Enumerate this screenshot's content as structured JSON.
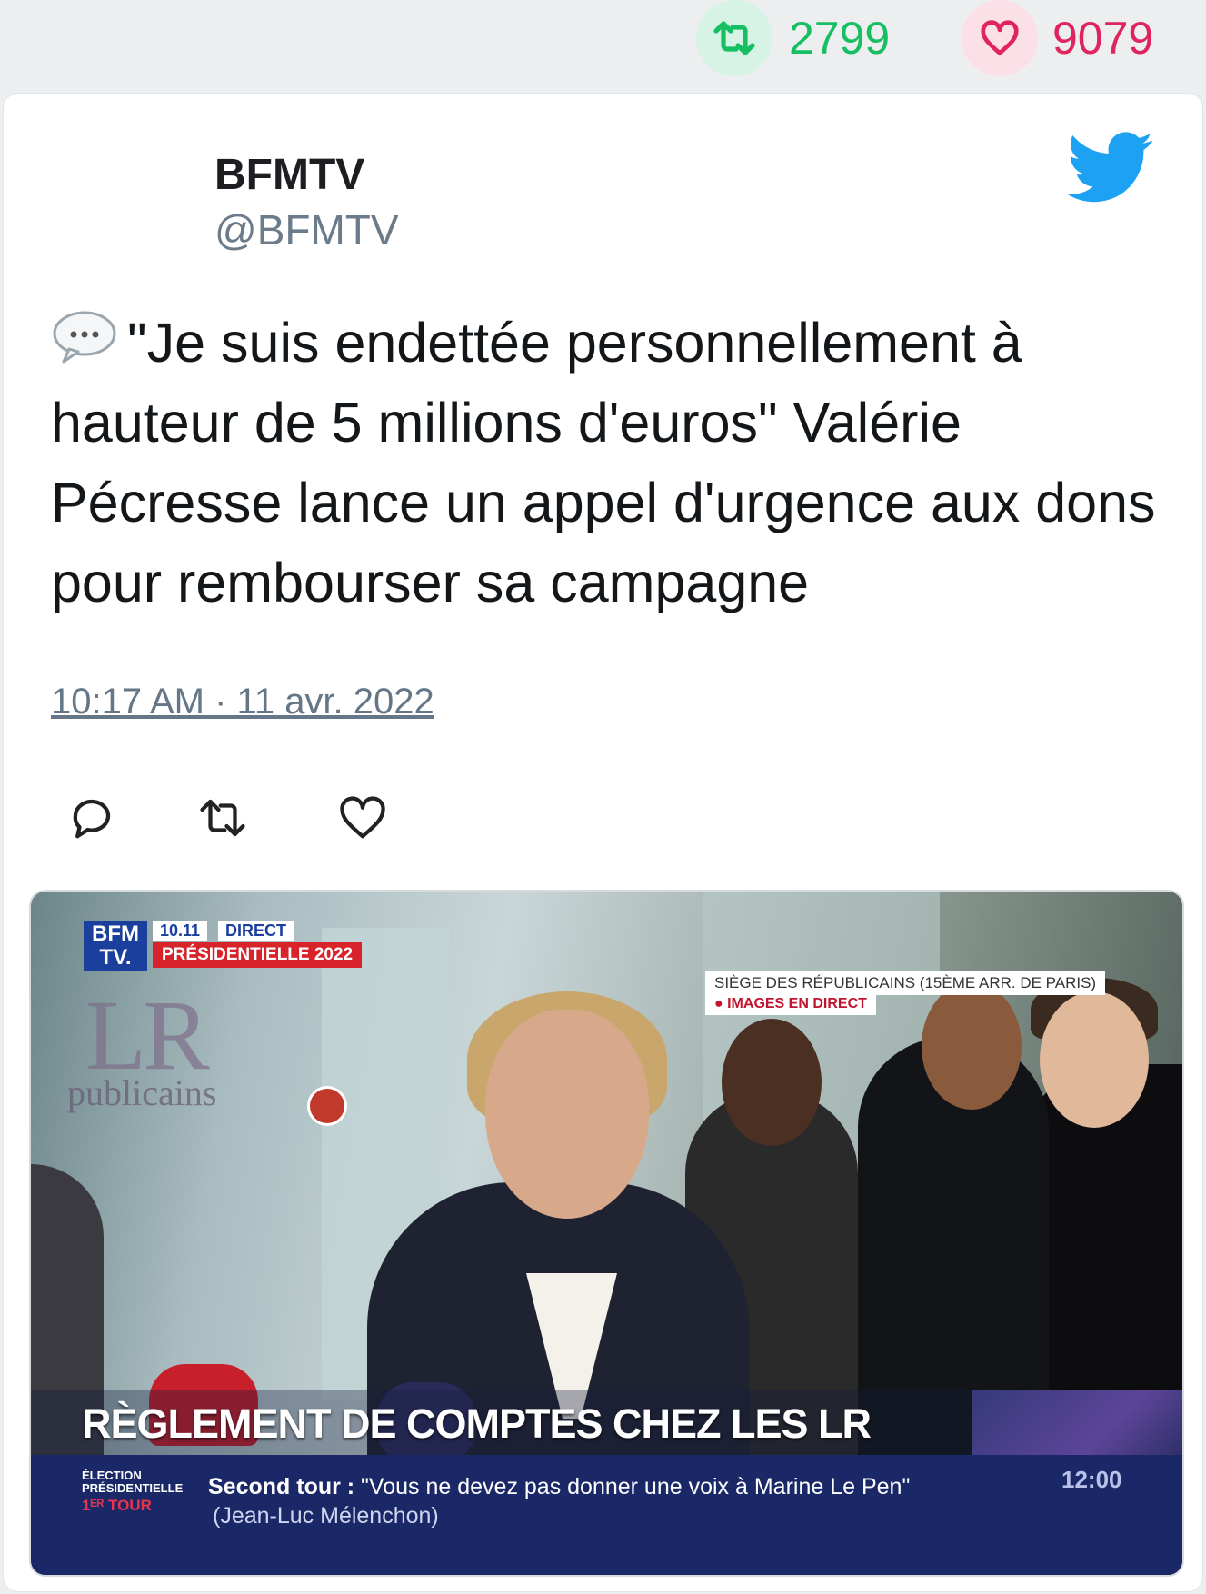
{
  "stats": {
    "retweets": "2799",
    "likes": "9079"
  },
  "colors": {
    "retweet": "#17bf63",
    "like": "#e0245e",
    "twitter_blue": "#1da1f2"
  },
  "tweet": {
    "name": "BFMTV",
    "handle": "@BFMTV",
    "text": "\"Je suis endettée personnellement à hauteur de 5 millions d'euros\" Valérie Pécresse lance un appel d'urgence aux dons pour rembourser sa campagne",
    "timestamp": "10:17 AM · 11 avr. 2022",
    "icons": [
      "speech-balloon-icon",
      "twitter-bird-icon",
      "reply-icon",
      "retweet-icon",
      "like-icon"
    ]
  },
  "media": {
    "logo": "BFM TV.",
    "time": "10.11",
    "direct": "DIRECT",
    "tag": "PRÉSIDENTIELLE 2022",
    "location": "SIÈGE DES RÉPUBLICAINS (15ÈME ARR. DE PARIS)",
    "live": "● IMAGES EN DIRECT",
    "wall_logo": "LR",
    "wall_text": "publicains",
    "headline": "RÈGLEMENT DE COMPTES CHEZ LES LR",
    "ticker_label": "ÉLECTION PRÉSIDENTIELLE",
    "ticker_tour": "1ᴱᴿ TOUR",
    "ticker_bold": "Second tour :",
    "ticker_text": " \"Vous ne devez pas donner une voix à Marine Le Pen\"",
    "ticker_sub": "(Jean-Luc Mélenchon)",
    "ticker_clock": "12:00"
  }
}
